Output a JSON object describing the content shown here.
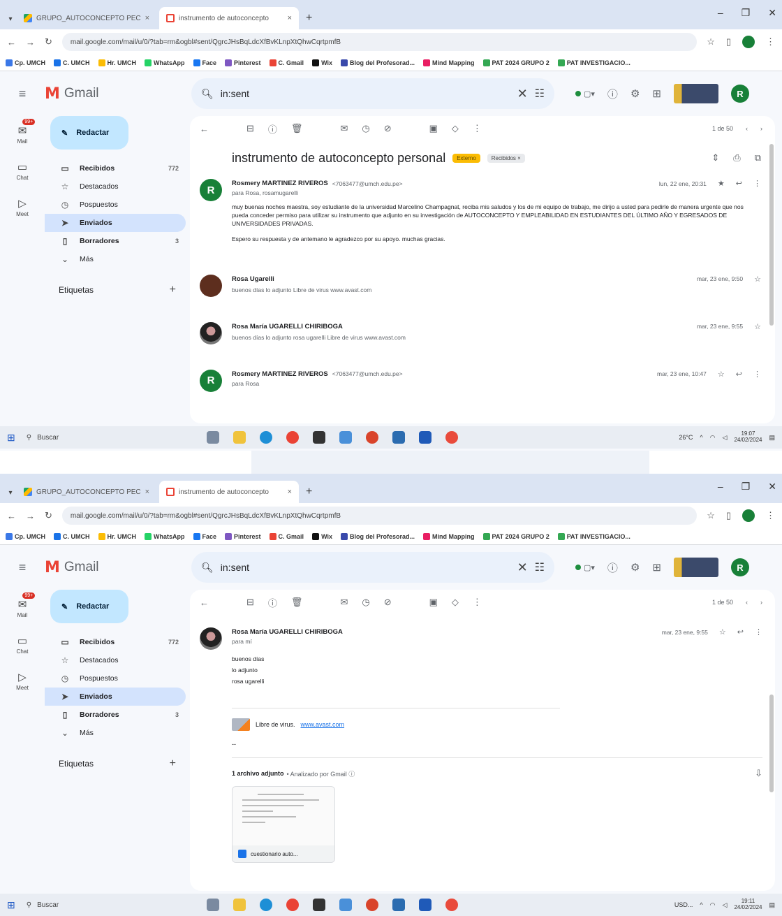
{
  "shot1": {
    "tabs": [
      {
        "label": "GRUPO_AUTOCONCEPTO PEC"
      },
      {
        "label": "instrumento de autoconcepto"
      }
    ],
    "url": "mail.google.com/mail/u/0/?tab=rm&ogbl#sent/QgrcJHsBqLdcXfBvKLnpXtQhwCqrtpmfB",
    "bookmarks": [
      "Cp. UMCH",
      "C. UMCH",
      "Hr. UMCH",
      "WhatsApp",
      "Face",
      "Pinterest",
      "C. Gmail",
      "Wix",
      "Blog del Profesorad...",
      "Mind Mapping",
      "PAT 2024 GRUPO 2",
      "PAT INVESTIGACIO..."
    ],
    "search_value": "in:sent",
    "compose_label": "Redactar",
    "rail": [
      {
        "label": "Mail",
        "badge": "99+"
      },
      {
        "label": "Chat"
      },
      {
        "label": "Meet"
      }
    ],
    "nav": [
      {
        "label": "Recibidos",
        "count": "772"
      },
      {
        "label": "Destacados",
        "count": ""
      },
      {
        "label": "Pospuestos",
        "count": ""
      },
      {
        "label": "Enviados",
        "count": ""
      },
      {
        "label": "Borradores",
        "count": "3"
      },
      {
        "label": "Más",
        "count": ""
      }
    ],
    "labels_heading": "Etiquetas",
    "pagination": "1 de 50",
    "subject": "instrumento de autoconcepto personal",
    "label_chips": [
      "Externo",
      "Recibidos ×"
    ],
    "messages": [
      {
        "sender": "Rosmery MARTINEZ RIVEROS",
        "email": "<7063477@umch.edu.pe>",
        "to": "para Rosa, rosamugarelli",
        "time": "lun, 22 ene, 20:31",
        "body": [
          "muy buenas noches maestra, soy estudiante de la universidad Marcelino Champagnat, reciba mis saludos y los de mi equipo de trabajo, me dirijo a usted para pedirle de manera urgente que nos pueda conceder permiso para utilizar su instrumento que adjunto en su investigación de AUTOCONCEPTO Y EMPLEABILIDAD EN ESTUDIANTES DEL ÚLTIMO AÑO Y EGRESADOS DE UNIVERSIDADES PRIVADAS.",
          "Espero su respuesta y de antemano le agradezco por su apoyo. muchas gracias."
        ]
      },
      {
        "sender": "Rosa Ugarelli",
        "snippet": "buenos días lo adjunto Libre de virus www.avast.com",
        "time": "mar, 23 ene, 9:50"
      },
      {
        "sender": "Rosa María UGARELLI CHIRIBOGA",
        "snippet": "buenos días lo adjunto rosa ugarelli Libre de virus www.avast.com",
        "time": "mar, 23 ene, 9:55"
      },
      {
        "sender": "Rosmery MARTINEZ RIVEROS",
        "email": "<7063477@umch.edu.pe>",
        "to": "para Rosa",
        "time": "mar, 23 ene, 10:47"
      }
    ],
    "taskbar": {
      "search": "Buscar",
      "weather": "26°C",
      "time": "19:07",
      "date": "24/02/2024"
    }
  },
  "shot2": {
    "tabs": [
      {
        "label": "GRUPO_AUTOCONCEPTO PEC"
      },
      {
        "label": "instrumento de autoconcepto"
      }
    ],
    "url": "mail.google.com/mail/u/0/?tab=rm&ogbl#sent/QgrcJHsBqLdcXfBvKLnpXtQhwCqrtpmfB",
    "bookmarks": [
      "Cp. UMCH",
      "C. UMCH",
      "Hr. UMCH",
      "WhatsApp",
      "Face",
      "Pinterest",
      "C. Gmail",
      "Wix",
      "Blog del Profesorad...",
      "Mind Mapping",
      "PAT 2024 GRUPO 2",
      "PAT INVESTIGACIO..."
    ],
    "search_value": "in:sent",
    "compose_label": "Redactar",
    "rail": [
      {
        "label": "Mail",
        "badge": "99+"
      },
      {
        "label": "Chat"
      },
      {
        "label": "Meet"
      }
    ],
    "nav": [
      {
        "label": "Recibidos",
        "count": "772"
      },
      {
        "label": "Destacados",
        "count": ""
      },
      {
        "label": "Pospuestos",
        "count": ""
      },
      {
        "label": "Enviados",
        "count": ""
      },
      {
        "label": "Borradores",
        "count": "3"
      },
      {
        "label": "Más",
        "count": ""
      }
    ],
    "labels_heading": "Etiquetas",
    "pagination": "1 de 50",
    "message": {
      "sender": "Rosa María UGARELLI CHIRIBOGA",
      "to": "para mí",
      "time": "mar, 23 ene, 9:55",
      "body": [
        "buenos días",
        "lo adjunto",
        "rosa ugarelli"
      ],
      "signature_text": "Libre de virus.",
      "signature_link": "www.avast.com",
      "dashes": "--"
    },
    "attachment": {
      "heading": "1 archivo adjunto",
      "scanned": "• Analizado por Gmail ⓘ",
      "file": "cuestionario auto..."
    },
    "taskbar": {
      "search": "Buscar",
      "weather": "USD...",
      "time": "19:11",
      "date": "24/02/2024"
    }
  }
}
